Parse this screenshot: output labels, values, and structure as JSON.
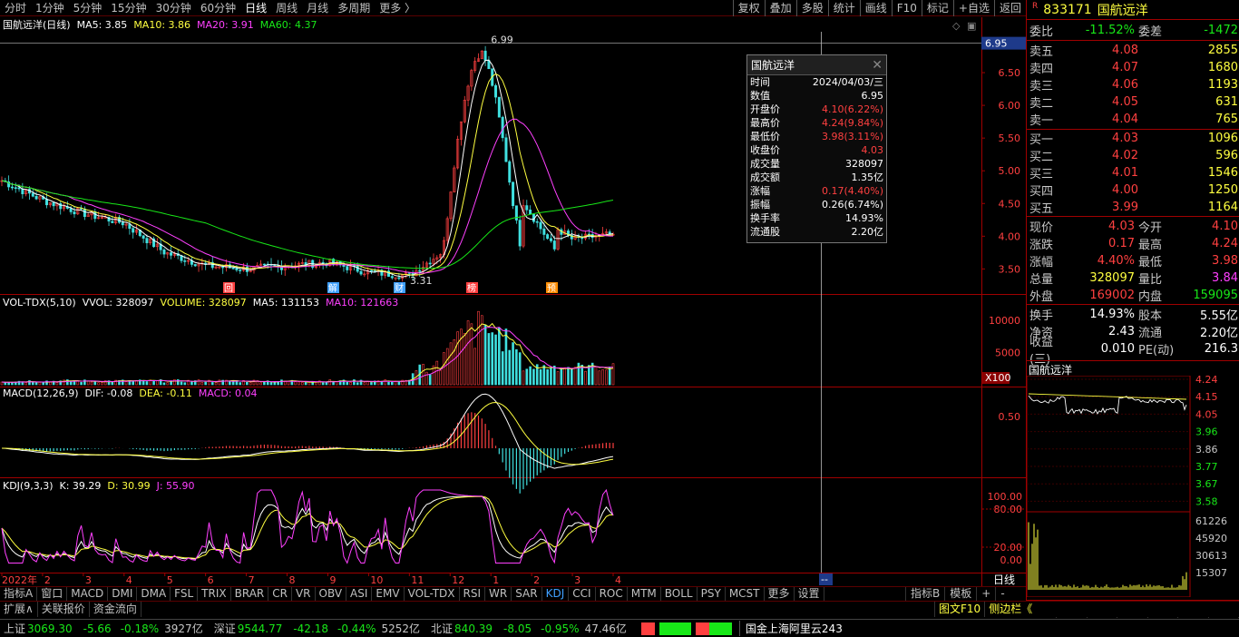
{
  "periods": [
    "分时",
    "1分钟",
    "5分钟",
    "15分钟",
    "30分钟",
    "60分钟",
    "日线",
    "周线",
    "月线",
    "多周期",
    "更多"
  ],
  "toolbar": [
    "复权",
    "叠加",
    "多股",
    "统计",
    "画线",
    "F10",
    "标记",
    "+自选",
    "返回"
  ],
  "stock": {
    "code": "833171",
    "name": "国航远洋",
    "flag": "R"
  },
  "main": {
    "title": "国航远洋(日线)",
    "ma5": "MA5: 3.85",
    "ma10": "MA10: 3.86",
    "ma20": "MA20: 3.91",
    "ma60": "MA60: 4.37",
    "high_label": "6.99",
    "low_label": "3.31",
    "cursor_price": "6.95",
    "y_ticks": [
      "6.50",
      "6.00",
      "5.50",
      "5.00",
      "4.50",
      "4.00",
      "3.50"
    ],
    "events": [
      "回",
      "解",
      "财",
      "榜",
      "预"
    ]
  },
  "vol": {
    "title": "VOL-TDX(5,10)",
    "vvol": "VVOL: 328097",
    "volume": "VOLUME: 328097",
    "ma5": "MA5: 131153",
    "ma10": "MA10: 121663",
    "y_ticks": [
      "10000",
      "5000"
    ],
    "unit": "X100"
  },
  "macd": {
    "title": "MACD(12,26,9)",
    "dif": "DIF: -0.08",
    "dea": "DEA: -0.11",
    "macd": "MACD: 0.04",
    "y_ticks": [
      "0.50"
    ]
  },
  "kdj": {
    "title": "KDJ(9,3,3)",
    "k": "K: 39.29",
    "d": "D: 30.99",
    "j": "J: 55.90",
    "y_ticks": [
      "100.00",
      "80.00",
      "20.00",
      "0.00"
    ]
  },
  "xaxis": {
    "labels": [
      "2022年",
      "2",
      "3",
      "4",
      "5",
      "6",
      "7",
      "8",
      "9",
      "10",
      "11",
      "12",
      "1",
      "2",
      "3",
      "4"
    ],
    "cursor": "--",
    "period": "日线"
  },
  "popup": {
    "title": "国航远洋",
    "rows": [
      {
        "k": "时间",
        "v": "2024/04/03/三",
        "c": "#fff"
      },
      {
        "k": "数值",
        "v": "6.95",
        "c": "#fff"
      },
      {
        "k": "开盘价",
        "v": "4.10(6.22%)",
        "c": "#ff4040"
      },
      {
        "k": "最高价",
        "v": "4.24(9.84%)",
        "c": "#ff4040"
      },
      {
        "k": "最低价",
        "v": "3.98(3.11%)",
        "c": "#ff4040"
      },
      {
        "k": "收盘价",
        "v": "4.03",
        "c": "#ff4040"
      },
      {
        "k": "成交量",
        "v": "328097",
        "c": "#fff"
      },
      {
        "k": "成交额",
        "v": "1.35亿",
        "c": "#fff"
      },
      {
        "k": "涨幅",
        "v": "0.17(4.40%)",
        "c": "#ff4040"
      },
      {
        "k": "振幅",
        "v": "0.26(6.74%)",
        "c": "#fff"
      },
      {
        "k": "换手率",
        "v": "14.93%",
        "c": "#fff"
      },
      {
        "k": "流通股",
        "v": "2.20亿",
        "c": "#fff"
      }
    ]
  },
  "quote": {
    "webi_label": "委比",
    "webi": "-11.52%",
    "wecha_label": "委差",
    "wecha": "-1472",
    "sells": [
      {
        "l": "卖五",
        "p": "4.08",
        "v": "2855"
      },
      {
        "l": "卖四",
        "p": "4.07",
        "v": "1680"
      },
      {
        "l": "卖三",
        "p": "4.06",
        "v": "1193"
      },
      {
        "l": "卖二",
        "p": "4.05",
        "v": "631"
      },
      {
        "l": "卖一",
        "p": "4.04",
        "v": "765"
      }
    ],
    "buys": [
      {
        "l": "买一",
        "p": "4.03",
        "v": "1096"
      },
      {
        "l": "买二",
        "p": "4.02",
        "v": "596"
      },
      {
        "l": "买三",
        "p": "4.01",
        "v": "1546"
      },
      {
        "l": "买四",
        "p": "4.00",
        "v": "1250"
      },
      {
        "l": "买五",
        "p": "3.99",
        "v": "1164"
      }
    ],
    "stats": [
      {
        "l1": "现价",
        "v1": "4.03",
        "c1": "#ff4040",
        "l2": "今开",
        "v2": "4.10",
        "c2": "#ff4040"
      },
      {
        "l1": "涨跌",
        "v1": "0.17",
        "c1": "#ff4040",
        "l2": "最高",
        "v2": "4.24",
        "c2": "#ff4040"
      },
      {
        "l1": "涨幅",
        "v1": "4.40%",
        "c1": "#ff4040",
        "l2": "最低",
        "v2": "3.98",
        "c2": "#ff4040"
      },
      {
        "l1": "总量",
        "v1": "328097",
        "c1": "#ffff40",
        "l2": "量比",
        "v2": "3.84",
        "c2": "#ff40ff"
      },
      {
        "l1": "外盘",
        "v1": "169002",
        "c1": "#ff4040",
        "l2": "内盘",
        "v2": "159095",
        "c2": "#18e818"
      }
    ],
    "stats2": [
      {
        "l1": "换手",
        "v1": "14.93%",
        "c1": "#fff",
        "l2": "股本",
        "v2": "5.55亿",
        "c2": "#fff"
      },
      {
        "l1": "净资",
        "v1": "2.43",
        "c1": "#fff",
        "l2": "流通",
        "v2": "2.20亿",
        "c2": "#fff"
      },
      {
        "l1": "收益(三)",
        "v1": "0.010",
        "c1": "#fff",
        "l2": "PE(动)",
        "v2": "216.3",
        "c2": "#fff"
      }
    ]
  },
  "mini": {
    "title": "国航远洋",
    "prices": [
      "4.24",
      "4.15",
      "4.05",
      "3.96",
      "3.86",
      "3.77",
      "3.67",
      "3.58"
    ],
    "vols": [
      "61226",
      "45920",
      "30613",
      "15307"
    ]
  },
  "right_tabs": [
    "笔",
    "价",
    "细",
    "势",
    "联",
    "值",
    "主"
  ],
  "bottom_tabs": [
    "指标A",
    "窗口",
    "MACD",
    "DMI",
    "DMA",
    "FSL",
    "TRIX",
    "BRAR",
    "CR",
    "VR",
    "OBV",
    "ASI",
    "EMV",
    "VOL-TDX",
    "RSI",
    "WR",
    "SAR",
    "KDJ",
    "CCI",
    "ROC",
    "MTM",
    "BOLL",
    "PSY",
    "MCST",
    "更多",
    "设置"
  ],
  "bottom_right": [
    "指标B",
    "模板",
    "+",
    "-"
  ],
  "ext_tabs": [
    "扩展∧",
    "关联报价",
    "资金流向"
  ],
  "ext_right": [
    "图文F10",
    "侧边栏《"
  ],
  "status": {
    "sh": {
      "n": "上证",
      "v": "3069.30",
      "c": "-5.66",
      "p": "-0.18%",
      "a": "3927亿"
    },
    "sz": {
      "n": "深证",
      "v": "9544.77",
      "c": "-42.18",
      "p": "-0.44%",
      "a": "5252亿"
    },
    "bz": {
      "n": "北证",
      "v": "840.39",
      "c": "-8.05",
      "p": "-0.95%",
      "a": "47.46亿"
    },
    "server": "国金上海阿里云243"
  },
  "chart_data": {
    "type": "candlestick",
    "title": "国航远洋(日线)",
    "ylim": [
      3.2,
      7.0
    ],
    "points": [
      [
        "2022-01",
        4.85
      ],
      [
        "2022-02",
        4.55
      ],
      [
        "2022-03",
        4.35
      ],
      [
        "2022-04",
        4.2
      ],
      [
        "2022-05",
        3.75
      ],
      [
        "2022-06",
        3.55
      ],
      [
        "2022-07",
        3.5
      ],
      [
        "2022-08",
        3.55
      ],
      [
        "2022-09",
        3.6
      ],
      [
        "2022-10",
        3.45
      ],
      [
        "2022-11",
        3.4
      ],
      [
        "2022-12",
        3.85
      ],
      [
        "2023-01",
        6.99
      ],
      [
        "2023-02",
        4.4
      ],
      [
        "2023-03",
        3.95
      ],
      [
        "2023-04",
        4.03
      ]
    ]
  }
}
